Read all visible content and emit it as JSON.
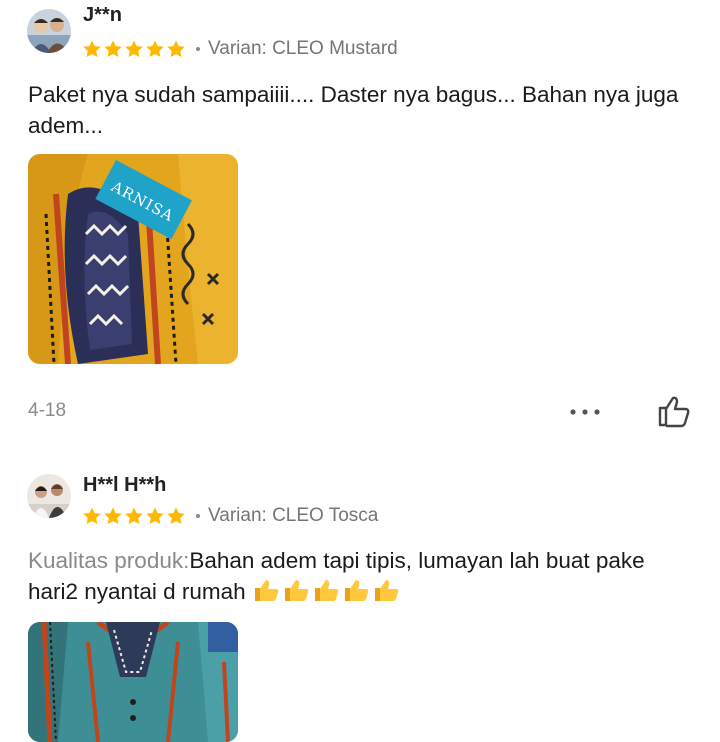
{
  "reviews": [
    {
      "username": "J**n",
      "rating": 5,
      "variant": "Varian: CLEO Mustard",
      "text": "Paket nya sudah sampaiiii.... Daster nya bagus... Bahan nya juga adem...",
      "photo_brand": "ARNISA",
      "date": "4-18",
      "icons": {
        "more": "more-dots-icon",
        "like": "thumbs-up-outline-icon"
      }
    },
    {
      "username": "H**l H**h",
      "rating": 5,
      "variant": "Varian: CLEO Tosca",
      "quality_label": "Kualitas produk:",
      "text": "Bahan adem tapi tipis, lumayan lah buat pake hari2 nyantai d rumah",
      "emoji": "👍👍👍👍👍"
    }
  ],
  "colors": {
    "star": "#FFB800",
    "muted_text": "#8a8a8a",
    "mustard": "#E3A51E",
    "tosca": "#3E8E96"
  }
}
